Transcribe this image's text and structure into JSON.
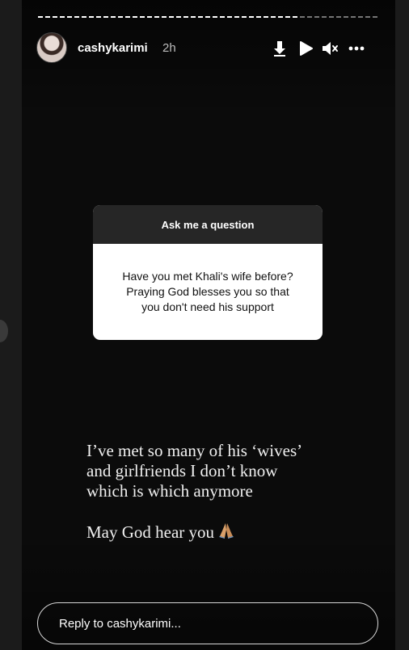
{
  "story": {
    "progress_fraction": 0.76,
    "username": "cashykarimi",
    "time": "2h",
    "controls": {
      "download_icon": "download-icon",
      "play_icon": "play-icon",
      "mute_icon": "mute-icon",
      "more_icon": "more-icon"
    }
  },
  "question_card": {
    "header": "Ask me a question",
    "lines": [
      "Have you met Khali's wife before?",
      "Praying God blesses you so that",
      "you don't need his support"
    ]
  },
  "answer": {
    "lines": [
      "I’ve met so many of his ‘wives’",
      "and girlfriends I don’t know",
      "which is which anymore"
    ],
    "closing": "May God hear you",
    "emoji_icon": "praying-hands-icon"
  },
  "reply": {
    "placeholder": "Reply to cashykarimi..."
  },
  "colors": {
    "background": "#0b0b0b",
    "card_header": "#262626",
    "card_body": "#ffffff"
  }
}
